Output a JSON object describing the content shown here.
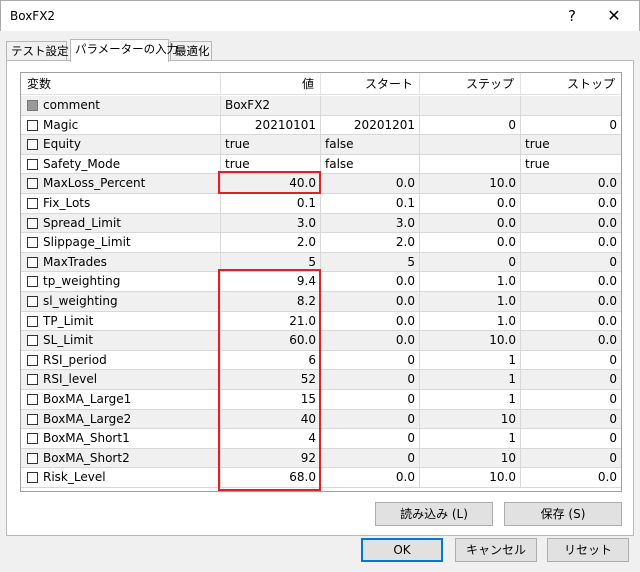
{
  "window": {
    "title": "BoxFX2",
    "help": "?",
    "close": "✕"
  },
  "tabs": [
    {
      "label": "テスト設定"
    },
    {
      "label": "パラメーターの入力"
    },
    {
      "label": "最適化"
    }
  ],
  "columns": {
    "name": "変数",
    "value": "値",
    "start": "スタート",
    "step": "ステップ",
    "stop": "ストップ"
  },
  "rows": [
    {
      "name": "comment",
      "value": "BoxFX2",
      "start": "",
      "step": "",
      "stop": "",
      "value_align": "left",
      "start_align": "left",
      "stop_align": "left",
      "disabled": true
    },
    {
      "name": "Magic",
      "value": "20210101",
      "start": "20201201",
      "step": "0",
      "stop": "0",
      "value_align": "right",
      "start_align": "right",
      "stop_align": "right"
    },
    {
      "name": "Equity",
      "value": "true",
      "start": "false",
      "step": "",
      "stop": "true",
      "value_align": "left",
      "start_align": "left",
      "stop_align": "left"
    },
    {
      "name": "Safety_Mode",
      "value": "true",
      "start": "false",
      "step": "",
      "stop": "true",
      "value_align": "left",
      "start_align": "left",
      "stop_align": "left"
    },
    {
      "name": "MaxLoss_Percent",
      "value": "40.0",
      "start": "0.0",
      "step": "10.0",
      "stop": "0.0",
      "value_align": "right",
      "start_align": "right",
      "stop_align": "right"
    },
    {
      "name": "Fix_Lots",
      "value": "0.1",
      "start": "0.1",
      "step": "0.0",
      "stop": "0.0",
      "value_align": "right",
      "start_align": "right",
      "stop_align": "right"
    },
    {
      "name": "Spread_Limit",
      "value": "3.0",
      "start": "3.0",
      "step": "0.0",
      "stop": "0.0",
      "value_align": "right",
      "start_align": "right",
      "stop_align": "right"
    },
    {
      "name": "Slippage_Limit",
      "value": "2.0",
      "start": "2.0",
      "step": "0.0",
      "stop": "0.0",
      "value_align": "right",
      "start_align": "right",
      "stop_align": "right"
    },
    {
      "name": "MaxTrades",
      "value": "5",
      "start": "5",
      "step": "0",
      "stop": "0",
      "value_align": "right",
      "start_align": "right",
      "stop_align": "right"
    },
    {
      "name": "tp_weighting",
      "value": "9.4",
      "start": "0.0",
      "step": "1.0",
      "stop": "0.0",
      "value_align": "right",
      "start_align": "right",
      "stop_align": "right"
    },
    {
      "name": "sl_weighting",
      "value": "8.2",
      "start": "0.0",
      "step": "1.0",
      "stop": "0.0",
      "value_align": "right",
      "start_align": "right",
      "stop_align": "right"
    },
    {
      "name": "TP_Limit",
      "value": "21.0",
      "start": "0.0",
      "step": "1.0",
      "stop": "0.0",
      "value_align": "right",
      "start_align": "right",
      "stop_align": "right"
    },
    {
      "name": "SL_Limit",
      "value": "60.0",
      "start": "0.0",
      "step": "10.0",
      "stop": "0.0",
      "value_align": "right",
      "start_align": "right",
      "stop_align": "right"
    },
    {
      "name": "RSI_period",
      "value": "6",
      "start": "0",
      "step": "1",
      "stop": "0",
      "value_align": "right",
      "start_align": "right",
      "stop_align": "right"
    },
    {
      "name": "RSI_level",
      "value": "52",
      "start": "0",
      "step": "1",
      "stop": "0",
      "value_align": "right",
      "start_align": "right",
      "stop_align": "right"
    },
    {
      "name": "BoxMA_Large1",
      "value": "15",
      "start": "0",
      "step": "1",
      "stop": "0",
      "value_align": "right",
      "start_align": "right",
      "stop_align": "right"
    },
    {
      "name": "BoxMA_Large2",
      "value": "40",
      "start": "0",
      "step": "10",
      "stop": "0",
      "value_align": "right",
      "start_align": "right",
      "stop_align": "right"
    },
    {
      "name": "BoxMA_Short1",
      "value": "4",
      "start": "0",
      "step": "1",
      "stop": "0",
      "value_align": "right",
      "start_align": "right",
      "stop_align": "right"
    },
    {
      "name": "BoxMA_Short2",
      "value": "92",
      "start": "0",
      "step": "10",
      "stop": "0",
      "value_align": "right",
      "start_align": "right",
      "stop_align": "right"
    },
    {
      "name": "Risk_Level",
      "value": "68.0",
      "start": "0.0",
      "step": "10.0",
      "stop": "0.0",
      "value_align": "right",
      "start_align": "right",
      "stop_align": "right"
    }
  ],
  "buttons": {
    "load": "読み込み (L)",
    "save": "保存 (S)",
    "ok": "OK",
    "cancel": "キャンセル",
    "reset": "リセット"
  },
  "colors": {
    "highlight": "#e41e26",
    "default_button_border": "#0078d7"
  }
}
